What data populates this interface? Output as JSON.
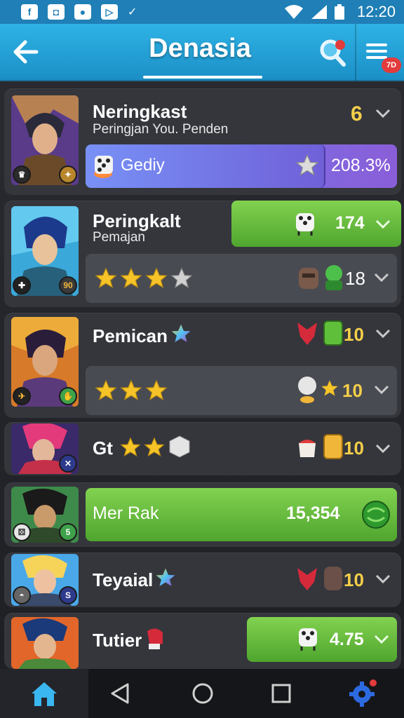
{
  "status_bar": {
    "time": "12:20",
    "notification_icons": [
      "facebook-icon",
      "video-icon",
      "pokeball-icon",
      "play-icon",
      "check-icon"
    ]
  },
  "app_bar": {
    "title": "Denasia",
    "notification_count": "7D"
  },
  "players": [
    {
      "name": "Neringkast",
      "subtitle": "Peringjan You. Penden",
      "value": "6",
      "bar_label": "Gediy",
      "bar_value": "208.3%"
    },
    {
      "name": "Peringkalt",
      "subtitle": "Pemajan",
      "pill_value": "174",
      "rating": 3,
      "rating_max": 4,
      "value": "18"
    },
    {
      "name": "Pemican",
      "value": "10",
      "rating": 3,
      "value2": "10"
    },
    {
      "name": "Gt",
      "rating": 2,
      "value": "10"
    },
    {
      "name": "Mer Rak",
      "bar_value": "15,354"
    },
    {
      "name": "Teyaial",
      "value": "10"
    },
    {
      "name": "Tutier",
      "pill_value": "4.75"
    }
  ],
  "colors": {
    "accent": "#2fb3e6",
    "card": "#34363c",
    "green": "#6cc045",
    "purple": "#7b62d8",
    "gold": "#f5cf4a"
  }
}
